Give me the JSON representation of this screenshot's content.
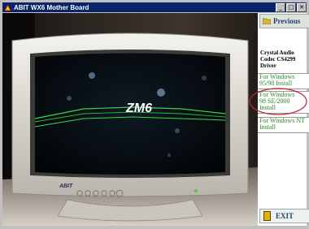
{
  "window": {
    "title": "ABIT WX6 Mother Board",
    "min_glyph": "_",
    "max_glyph": "□",
    "close_glyph": "✕"
  },
  "monitor": {
    "screen_text": "ZM6",
    "bezel_brand": "ABIT"
  },
  "sidebar": {
    "previous_label": "Previous",
    "section_title": [
      "Crystal Audio",
      "Codec CS4299",
      "Driver"
    ],
    "options": [
      {
        "lines": [
          "For Windows",
          "95/98 Install"
        ]
      },
      {
        "lines": [
          "For Windows",
          "98 SE/2000",
          "Install"
        ]
      },
      {
        "lines": [
          "For Windows NT",
          "Install"
        ]
      }
    ],
    "exit_label": "EXIT"
  }
}
